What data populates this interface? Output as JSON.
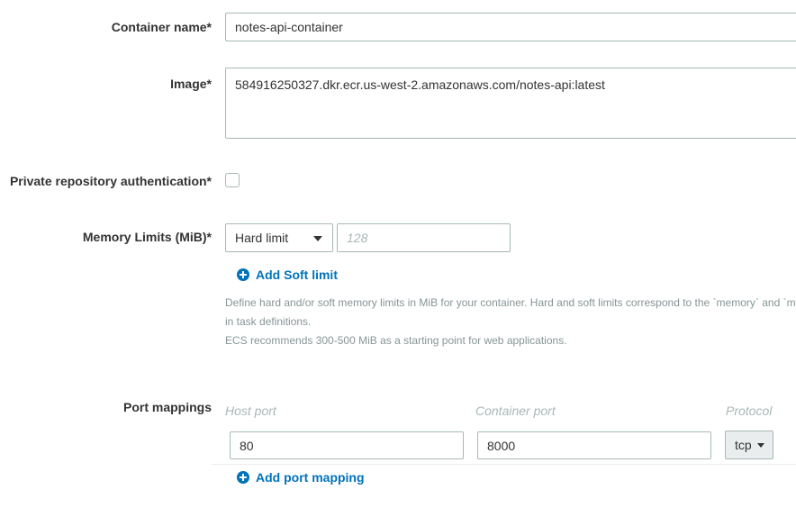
{
  "container_name": {
    "label": "Container name*",
    "value": "notes-api-container"
  },
  "image": {
    "label": "Image*",
    "value": "584916250327.dkr.ecr.us-west-2.amazonaws.com/notes-api:latest"
  },
  "private_repo_auth": {
    "label": "Private repository authentication*",
    "checked": false
  },
  "memory_limits": {
    "label": "Memory Limits (MiB)*",
    "limit_type": "Hard limit",
    "placeholder": "128",
    "add_soft_limit": "Add Soft limit",
    "help_lines": [
      "Define hard and/or soft memory limits in MiB for your container. Hard and soft limits correspond to the `memory` and `m",
      "in task definitions.",
      "ECS recommends 300-500 MiB as a starting point for web applications."
    ]
  },
  "port_mappings": {
    "label": "Port mappings",
    "columns": {
      "host": "Host port",
      "container": "Container port",
      "protocol": "Protocol"
    },
    "rows": [
      {
        "host_port": "80",
        "container_port": "8000",
        "protocol": "tcp"
      }
    ],
    "add_label": "Add port mapping"
  },
  "colors": {
    "link": "#0073bb",
    "border": "#aab7b8",
    "help_text": "#879596"
  },
  "icons": [
    "plus-circle-icon",
    "caret-down-icon"
  ]
}
